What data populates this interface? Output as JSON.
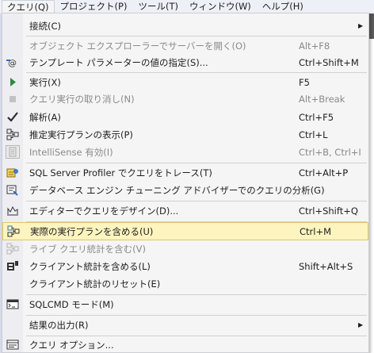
{
  "menubar": {
    "items": [
      {
        "label": "クエリ(Q)"
      },
      {
        "label": "プロジェクト(P)"
      },
      {
        "label": "ツール(T)"
      },
      {
        "label": "ウィンドウ(W)"
      },
      {
        "label": "ヘルプ(H)"
      }
    ]
  },
  "menu": {
    "items": [
      {
        "label": "接続(C)",
        "shortcut": "",
        "icon": "",
        "submenu": true
      },
      {
        "label": "オブジェクト エクスプローラーでサーバーを開く(O)",
        "shortcut": "Alt+F8",
        "icon": "",
        "disabled": true
      },
      {
        "label": "テンプレート パラメーターの値の指定(S)...",
        "shortcut": "Ctrl+Shift+M",
        "icon": "template-parameter-icon"
      },
      {
        "label": "実行(X)",
        "shortcut": "F5",
        "icon": "play-icon"
      },
      {
        "label": "クエリ実行の取り消し(N)",
        "shortcut": "Alt+Break",
        "icon": "stop-icon",
        "disabled": true
      },
      {
        "label": "解析(A)",
        "shortcut": "Ctrl+F5",
        "icon": "checkmark-icon"
      },
      {
        "label": "推定実行プランの表示(P)",
        "shortcut": "Ctrl+L",
        "icon": "execution-plan-icon"
      },
      {
        "label": "IntelliSense 有効(I)",
        "shortcut": "Ctrl+B, Ctrl+I",
        "icon": "intellisense-icon",
        "disabled": true
      },
      {
        "label": "SQL Server Profiler でクエリをトレース(T)",
        "shortcut": "Ctrl+Alt+P",
        "icon": "profiler-icon"
      },
      {
        "label": "データベース エンジン チューニング アドバイザーでのクエリの分析(G)",
        "shortcut": "",
        "icon": "tuning-advisor-icon"
      },
      {
        "label": "エディターでクエリをデザイン(D)...",
        "shortcut": "Ctrl+Shift+Q",
        "icon": "query-designer-icon"
      },
      {
        "label": "実際の実行プランを含める(U)",
        "shortcut": "Ctrl+M",
        "icon": "actual-plan-icon",
        "highlighted": true
      },
      {
        "label": "ライブ クエリ統計を含む(V)",
        "shortcut": "",
        "icon": "live-stats-icon",
        "disabled": true
      },
      {
        "label": "クライアント統計を含める(L)",
        "shortcut": "Shift+Alt+S",
        "icon": "client-stats-icon"
      },
      {
        "label": "クライアント統計のリセット(E)",
        "shortcut": "",
        "icon": ""
      },
      {
        "label": "SQLCMD モード(M)",
        "shortcut": "",
        "icon": "sqlcmd-icon"
      },
      {
        "label": "結果の出力(R)",
        "shortcut": "",
        "icon": "",
        "submenu": true
      },
      {
        "label": "クエリ オプション...",
        "shortcut": "",
        "icon": "query-options-icon"
      }
    ]
  }
}
